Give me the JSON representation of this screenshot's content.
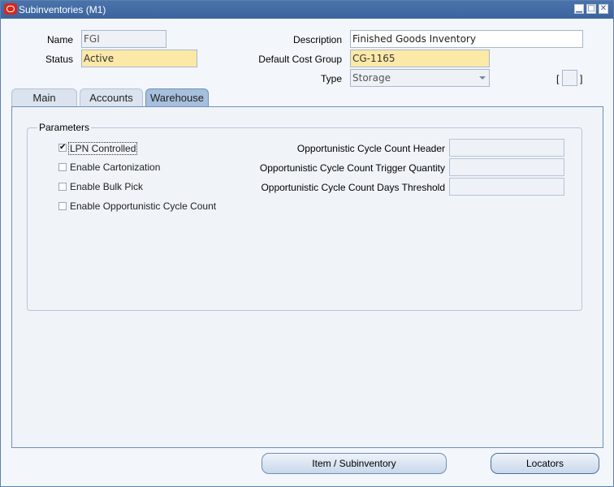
{
  "window": {
    "title": "Subinventories (M1)",
    "buttons": {
      "minimize": "▁",
      "maximize": "□",
      "close": "✕"
    }
  },
  "header": {
    "name_label": "Name",
    "name_value": "FGI",
    "status_label": "Status",
    "status_value": "Active",
    "description_label": "Description",
    "description_value": "Finished Goods Inventory",
    "cost_group_label": "Default Cost Group",
    "cost_group_value": "CG-1165",
    "type_label": "Type",
    "type_value": "Storage",
    "bracket_open": "[",
    "bracket_close": "]"
  },
  "tabs": [
    {
      "label": "Main",
      "active": false
    },
    {
      "label": "Accounts",
      "active": false
    },
    {
      "label": "Warehouse",
      "active": true
    }
  ],
  "parameters": {
    "title": "Parameters",
    "checkboxes": [
      {
        "label": "LPN Controlled",
        "checked": true,
        "mark": "✔"
      },
      {
        "label": "Enable Cartonization",
        "checked": false,
        "mark": ""
      },
      {
        "label": "Enable Bulk Pick",
        "checked": false,
        "mark": ""
      },
      {
        "label": "Enable Opportunistic Cycle Count",
        "checked": false,
        "mark": ""
      }
    ],
    "fields": [
      {
        "label": "Opportunistic Cycle Count Header",
        "value": ""
      },
      {
        "label": "Opportunistic Cycle Count Trigger Quantity",
        "value": ""
      },
      {
        "label": "Opportunistic Cycle Count Days Threshold",
        "value": ""
      }
    ]
  },
  "footer": {
    "item_subinventory_button": "Item / Subinventory",
    "locators_button": "Locators"
  },
  "colors": {
    "title_bar": "#3b649e",
    "required_field": "#fce9a8",
    "active_tab": "#a6bfdc"
  }
}
